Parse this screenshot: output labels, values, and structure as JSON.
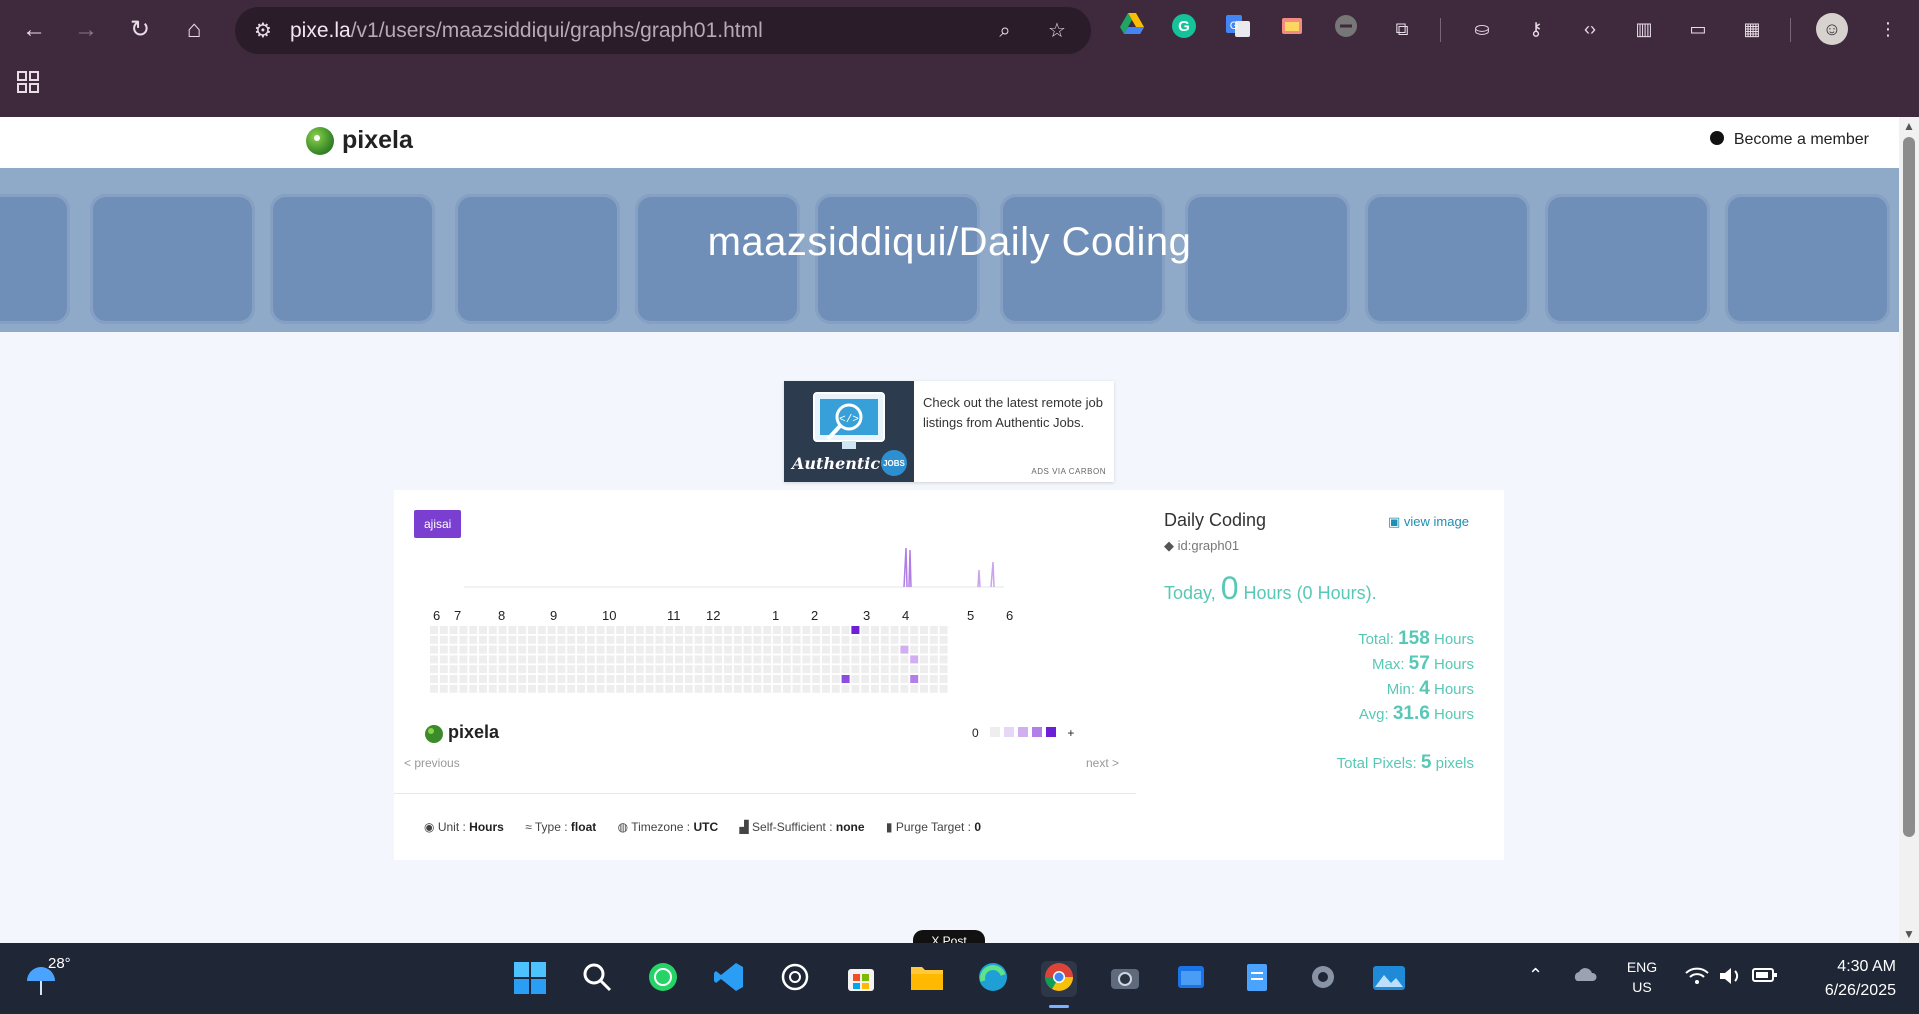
{
  "browser": {
    "url_host": "pixe.la",
    "url_path": "/v1/users/maazsiddiqui/graphs/graph01.html",
    "nav": {
      "back": "←",
      "forward": "→",
      "reload": "↻",
      "home": "⌂"
    },
    "extensions": [
      "google-drive-icon",
      "grammarly-icon",
      "google-translate-icon",
      "screenshot-icon",
      "vpn-icon",
      "extensions-icon",
      "incognito-icon",
      "password-icon",
      "devtools-icon",
      "sidebar-icon",
      "device-icon",
      "qr-icon"
    ]
  },
  "site": {
    "logo_text": "pixela",
    "member_link": "Become a member"
  },
  "banner": {
    "title": "maazsiddiqui/Daily Coding"
  },
  "ad": {
    "text": "Check out the latest remote job listings from Authentic Jobs.",
    "via": "ADS VIA CARBON",
    "brand": "Authentic",
    "brand_badge": "JOBS"
  },
  "graph": {
    "theme_badge": "ajisai",
    "months": [
      "6",
      "7",
      "8",
      "9",
      "10",
      "11",
      "12",
      "1",
      "2",
      "3",
      "4",
      "5",
      "6"
    ],
    "logo_text": "pixela",
    "legend_min": "0",
    "legend_max": "+",
    "prev": "< previous",
    "next": "next >",
    "colors": {
      "empty": "#eeeeee",
      "l1": "#e7d7f7",
      "l2": "#d0aef0",
      "l3": "#b27ee8",
      "l4": "#8a4de0",
      "l5": "#6c1fd6"
    }
  },
  "meta": {
    "unit_label": "Unit",
    "unit_value": "Hours",
    "type_label": "Type",
    "type_value": "float",
    "tz_label": "Timezone",
    "tz_value": "UTC",
    "self_label": "Self-Sufficient",
    "self_value": "none",
    "purge_label": "Purge Target",
    "purge_value": "0"
  },
  "info": {
    "title": "Daily Coding",
    "view_image": "view image",
    "id": "id:graph01",
    "today_prefix": "Today",
    "today_value": "0",
    "today_unit": "Hours",
    "today_paren": "(0 Hours).",
    "total_label": "Total:",
    "total_value": "158",
    "total_unit": "Hours",
    "max_label": "Max:",
    "max_value": "57",
    "max_unit": "Hours",
    "min_label": "Min:",
    "min_value": "4",
    "min_unit": "Hours",
    "avg_label": "Avg:",
    "avg_value": "31.6",
    "avg_unit": "Hours",
    "pixels_label": "Total Pixels:",
    "pixels_value": "5",
    "pixels_unit": "pixels"
  },
  "post_button": "X Post",
  "taskbar": {
    "weather_temp": "28°",
    "lang_top": "ENG",
    "lang_bottom": "US",
    "time": "4:30 AM",
    "date": "6/26/2025"
  }
}
